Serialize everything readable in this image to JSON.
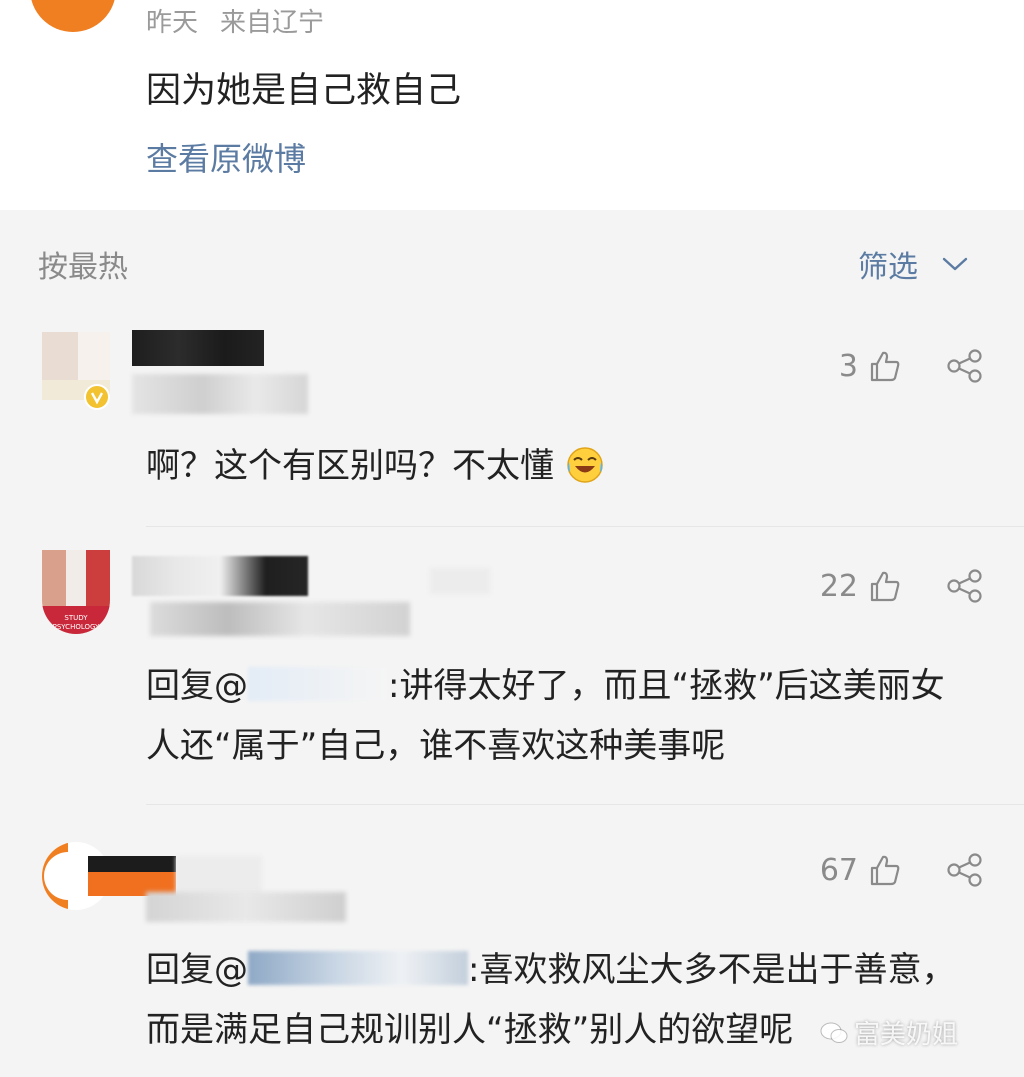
{
  "post": {
    "time": "昨天",
    "location": "来自辽宁",
    "text": "因为她是自己救自己",
    "view_original": "查看原微博"
  },
  "sort_bar": {
    "sort_label": "按最热",
    "filter_label": "筛选"
  },
  "comments": [
    {
      "text": "啊？这个有区别吗？不太懂",
      "emoji": "laughing-crying-emoji",
      "likes": "3"
    },
    {
      "reply_prefix": "回复@",
      "text": ":讲得太好了，而且“拯救”后这美丽女人还“属于”自己，谁不喜欢这种美事呢",
      "likes": "22",
      "avatar_caption": "STUDY PSYCHOLOGY"
    },
    {
      "reply_prefix": "回复@",
      "text": ":喜欢救风尘大多不是出于善意，而是满足自己规训别人“拯救”别人的欲望呢",
      "likes": "67"
    }
  ],
  "watermark": "富美奶姐",
  "colors": {
    "link": "#5b7ba3",
    "meta": "#9a9a9a",
    "background": "#f4f4f4"
  }
}
